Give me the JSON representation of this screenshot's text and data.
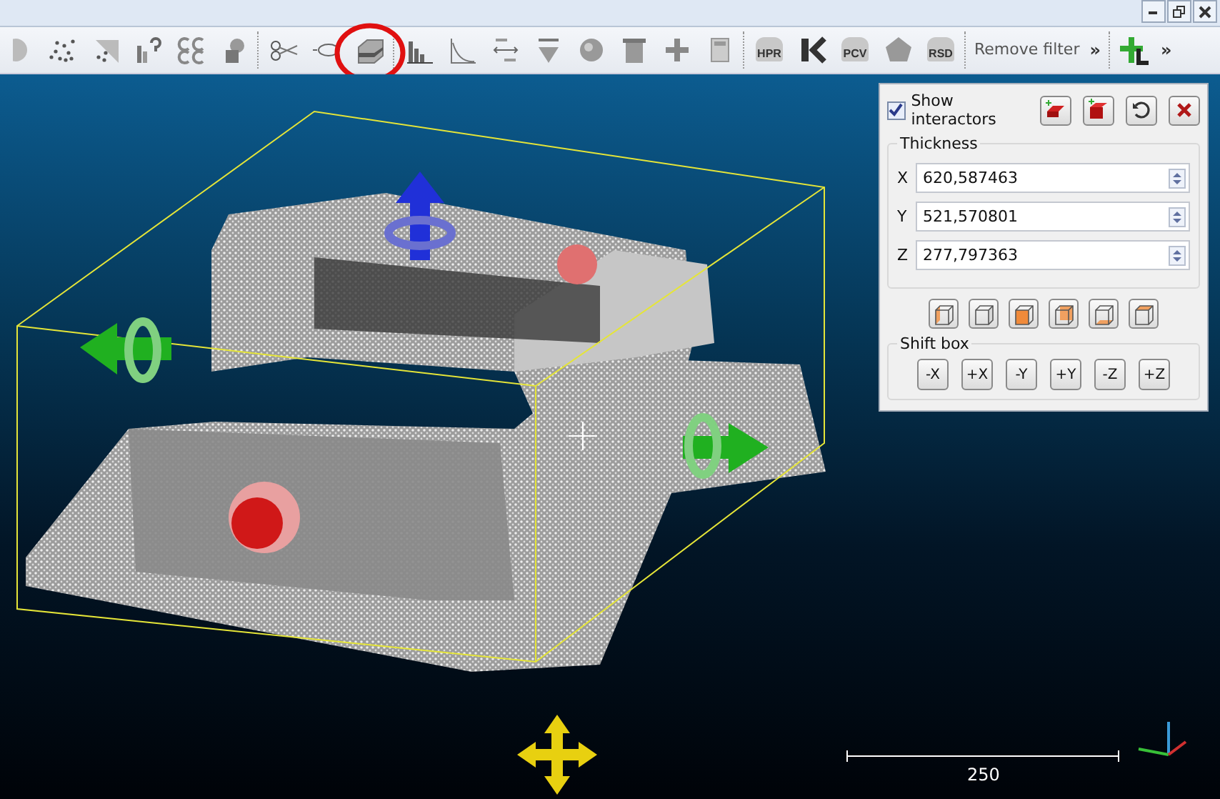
{
  "window": {
    "controls": [
      {
        "kind": "minimize"
      },
      {
        "kind": "restore"
      },
      {
        "kind": "close"
      }
    ]
  },
  "toolbar": {
    "tools": [
      {
        "kind": "partial",
        "highlighted": false
      },
      {
        "kind": "points",
        "highlighted": false
      },
      {
        "kind": "diagonal",
        "highlighted": false
      },
      {
        "kind": "hist-question",
        "highlighted": false
      },
      {
        "kind": "cc",
        "highlighted": false
      },
      {
        "kind": "shapes",
        "highlighted": false
      },
      {
        "kind": "sep"
      },
      {
        "kind": "scissors",
        "highlighted": false
      },
      {
        "kind": "segment",
        "highlighted": false
      },
      {
        "kind": "box",
        "highlighted": true
      },
      {
        "kind": "sep"
      },
      {
        "kind": "histogram",
        "highlighted": false
      },
      {
        "kind": "curve",
        "highlighted": false
      },
      {
        "kind": "minmax",
        "highlighted": false
      },
      {
        "kind": "funnel",
        "highlighted": false
      },
      {
        "kind": "sphere",
        "highlighted": false
      },
      {
        "kind": "trash",
        "highlighted": false
      },
      {
        "kind": "plus",
        "highlighted": false
      },
      {
        "kind": "calculator",
        "highlighted": false
      },
      {
        "kind": "sep"
      },
      {
        "kind": "captioned",
        "caption": "HPR",
        "highlighted": false
      },
      {
        "kind": "k",
        "highlighted": false
      },
      {
        "kind": "captioned",
        "caption": "PCV",
        "highlighted": false
      },
      {
        "kind": "pentagon",
        "highlighted": false
      },
      {
        "kind": "captioned",
        "caption": "RSD",
        "highlighted": false
      },
      {
        "kind": "sep"
      },
      {
        "kind": "text",
        "label": "Remove filter"
      },
      {
        "kind": "more",
        "label": "»"
      },
      {
        "kind": "sep"
      },
      {
        "kind": "plus-l",
        "highlighted": false
      },
      {
        "kind": "more",
        "label": "»"
      }
    ]
  },
  "panel": {
    "show_interactors": {
      "label": "Show interactors",
      "checked": true
    },
    "thickness": {
      "title": "Thickness",
      "fields": [
        {
          "axis": "X",
          "value": "620,587463"
        },
        {
          "axis": "Y",
          "value": "521,570801"
        },
        {
          "axis": "Z",
          "value": "277,797363"
        }
      ]
    },
    "faces": [
      {
        "kind": "left"
      },
      {
        "kind": "right"
      },
      {
        "kind": "front"
      },
      {
        "kind": "back"
      },
      {
        "kind": "bottom"
      },
      {
        "kind": "top"
      }
    ],
    "shift_box": {
      "title": "Shift box",
      "buttons": [
        "-X",
        "+X",
        "-Y",
        "+Y",
        "-Z",
        "+Z"
      ]
    }
  },
  "viewport": {
    "scale_bar": {
      "label": "250"
    }
  }
}
